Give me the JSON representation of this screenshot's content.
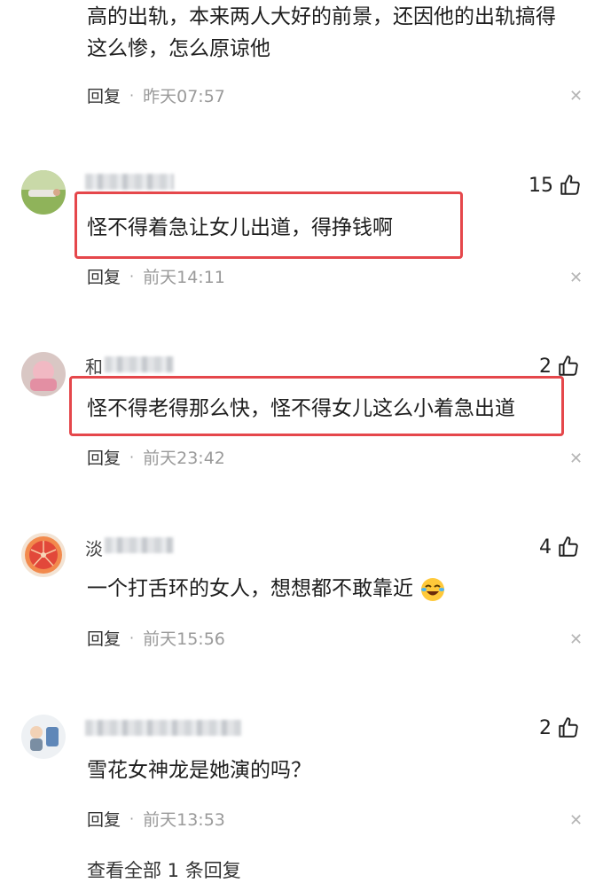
{
  "top_comment": {
    "lines": [
      "高的出轨，本来两人大好的前景，还因他的出轨搞得",
      "这么惨，怎么原谅他"
    ],
    "reply_label": "回复",
    "time": "昨天07:57"
  },
  "comments": [
    {
      "name_char": "",
      "likes": "15",
      "text": "怪不得着急让女儿出道，得挣钱啊",
      "reply_label": "回复",
      "time": "前天14:11",
      "highlight": true
    },
    {
      "name_char": "和",
      "likes": "2",
      "text": "怪不得老得那么快，怪不得女儿这么小着急出道",
      "reply_label": "回复",
      "time": "前天23:42",
      "highlight": true
    },
    {
      "name_char": "淡",
      "likes": "4",
      "text": "一个打舌环的女人，想想都不敢靠近",
      "reply_label": "回复",
      "time": "前天15:56",
      "highlight": false
    },
    {
      "name_char": "",
      "likes": "2",
      "text": "雪花女神龙是她演的吗？",
      "reply_label": "回复",
      "time": "前天13:53",
      "highlight": false
    }
  ],
  "bottom_text": "查看全部 1 条回复",
  "colors": {
    "highlight": "#e5474b",
    "meta": "#9a9a9a"
  }
}
